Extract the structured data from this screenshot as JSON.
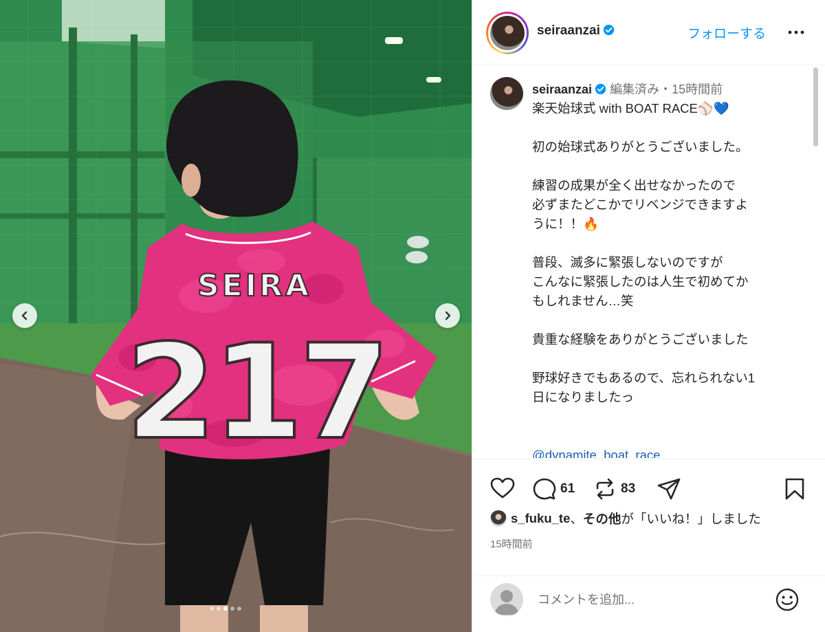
{
  "post": {
    "photo": {
      "jersey_name": "SEIRA",
      "jersey_number": "217",
      "carousel_count": 5,
      "carousel_active": 3,
      "colors": {
        "jersey": "#e2317f",
        "net": "#2f8a4d"
      }
    },
    "header": {
      "username": "seiraanzai",
      "follow_label": "フォローする"
    },
    "caption": {
      "username": "seiraanzai",
      "meta": "編集済み・15時間前",
      "lines": [
        "楽天始球式 with BOAT RACE⚾💙",
        "",
        "初の始球式ありがとうございました。",
        "",
        "練習の成果が全く出せなかったので",
        "必ずまたどこかでリベンジできますよ",
        "うに！！🔥",
        "",
        "普段、滅多に緊張しないのですが",
        "こんなに緊張したのは人生で初めてか",
        "もしれません…笑",
        "",
        "貴重な経験をありがとうございました",
        "",
        "野球好きでもあるので、忘れられない1",
        "日になりましたっ",
        "",
        "",
        "@dynamite_boat_race"
      ]
    },
    "actions": {
      "comment_count": "61",
      "repost_count": "83",
      "icons": [
        "heart-icon",
        "comment-icon",
        "repost-icon",
        "share-icon",
        "bookmark-icon"
      ]
    },
    "likes": {
      "user": "s_fuku_te",
      "separator": "、",
      "others": "その他",
      "suffix": "が「いいね！」しました"
    },
    "time_ago": "15時間前",
    "comment": {
      "placeholder": "コメントを追加..."
    },
    "accent_color": "#0095f6"
  }
}
